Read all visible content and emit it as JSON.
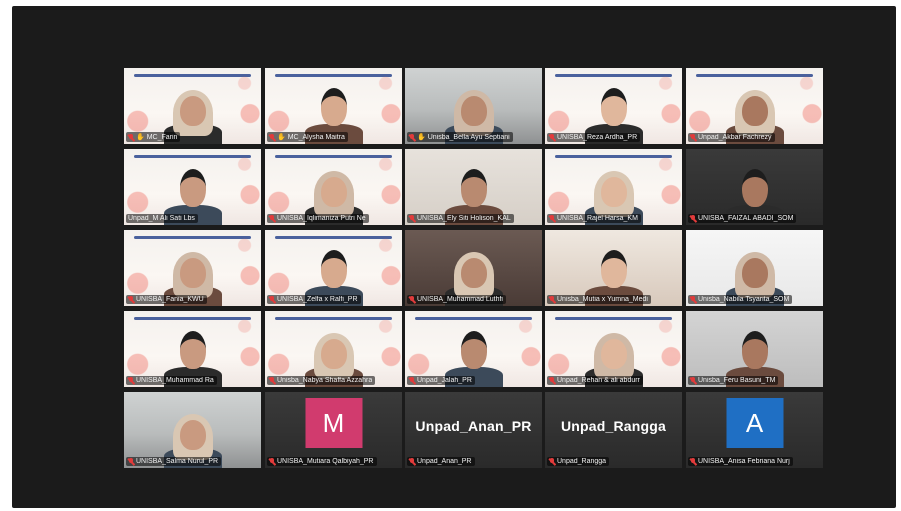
{
  "meeting": {
    "participants": [
      {
        "name": "MC_Farin",
        "bg": "banner",
        "hand": true,
        "muted": true
      },
      {
        "name": "MC_Alysha Maitra",
        "bg": "banner",
        "hand": true,
        "muted": true
      },
      {
        "name": "Unisba_Bella Ayu Septiani",
        "bg": "room",
        "hand": true,
        "muted": true
      },
      {
        "name": "UNISBA_Reza Ardha_PR",
        "bg": "banner",
        "hand": false,
        "muted": true
      },
      {
        "name": "Unpad_Akbar Fachrezy",
        "bg": "banner",
        "hand": false,
        "muted": true
      },
      {
        "name": "Unpad_M Ali Sati Lbs",
        "bg": "banner",
        "hand": false,
        "muted": false,
        "active": true
      },
      {
        "name": "UNISBA_Iqlimaniza Putri Ne",
        "bg": "banner",
        "hand": false,
        "muted": true
      },
      {
        "name": "UNISBA_Ely Siti Holison_KAL",
        "bg": "beige",
        "hand": false,
        "muted": true
      },
      {
        "name": "UNISBA_Rajel Harsa_KM",
        "bg": "banner",
        "hand": false,
        "muted": true
      },
      {
        "name": "UNISBA_FAIZAL ABADI_SOM",
        "bg": "dark",
        "hand": false,
        "muted": true
      },
      {
        "name": "UNISBA_Fania_KWU",
        "bg": "banner",
        "hand": false,
        "muted": true
      },
      {
        "name": "UNISBA_Zelfa x Ralfi_PR",
        "bg": "banner",
        "hand": false,
        "muted": true
      },
      {
        "name": "UNISBA_Muhammad Luthfi",
        "bg": "brownish",
        "hand": false,
        "muted": true
      },
      {
        "name": "Unisba_Mutia x Yumna_Medi",
        "bg": "warm",
        "hand": false,
        "muted": true
      },
      {
        "name": "Unisba_Nabila Tsyarita_SOM",
        "bg": "white",
        "hand": false,
        "muted": true
      },
      {
        "name": "UNISBA_Muhammad Ra",
        "bg": "banner",
        "hand": false,
        "muted": true
      },
      {
        "name": "Unisba_Nabya Shaffa Azzahra",
        "bg": "banner",
        "hand": false,
        "muted": true
      },
      {
        "name": "Unpad_Jalah_PR",
        "bg": "banner",
        "hand": false,
        "muted": true
      },
      {
        "name": "Unpad_Rehan & ali abdurr",
        "bg": "banner",
        "hand": false,
        "muted": true
      },
      {
        "name": "Unisba_Feru Basuni_TM",
        "bg": "gray",
        "hand": false,
        "muted": true
      },
      {
        "name": "UNISBA_Salma Nurul_PR",
        "bg": "room",
        "hand": false,
        "muted": true
      },
      {
        "name": "UNISBA_Mutiara Qalbiyah_PR",
        "bg": "dark",
        "hand": false,
        "muted": true,
        "avatar": "M",
        "avatar_color": "#d13b6e"
      },
      {
        "name": "Unpad_Anan_PR",
        "bg": "dark",
        "hand": false,
        "muted": true,
        "bigname": "Unpad_Anan_PR"
      },
      {
        "name": "Unpad_Rangga",
        "bg": "dark",
        "hand": false,
        "muted": true,
        "bigname": "Unpad_Rangga"
      },
      {
        "name": "UNISBA_Anisa Febriana Nurj",
        "bg": "dark",
        "hand": false,
        "muted": true,
        "avatar": "A",
        "avatar_color": "#1f6fc4"
      }
    ]
  }
}
